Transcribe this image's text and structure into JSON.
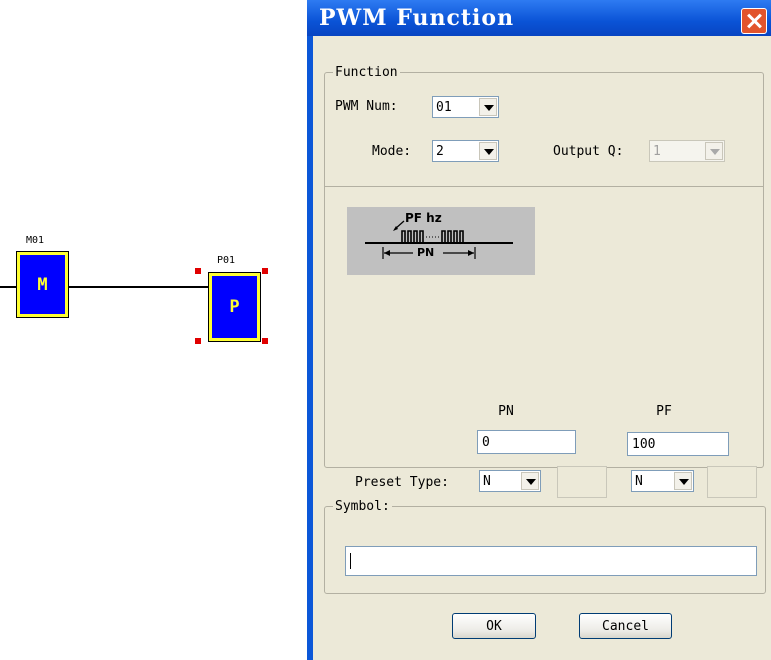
{
  "ladder": {
    "m_block": {
      "label": "M01",
      "letter": "M"
    },
    "p_block": {
      "label": "P01",
      "letter": "P"
    }
  },
  "dialog": {
    "title": "PWM Function",
    "function_group": {
      "legend": "Function",
      "pwm_num_label": "PWM Num:",
      "pwm_num_value": "01",
      "mode_label": "Mode:",
      "mode_value": "2",
      "output_q_label": "Output Q:",
      "output_q_value": "1"
    },
    "diagram": {
      "pf_text": "PF hz",
      "pn_text": "PN"
    },
    "params": {
      "pn_header": "PN",
      "pf_header": "PF",
      "pn_value": "0",
      "pf_value": "100",
      "preset_type_label": "Preset Type:",
      "pn_preset_type": "N",
      "pf_preset_type": "N"
    },
    "symbol_group": {
      "legend": "Symbol:",
      "value": ""
    },
    "buttons": {
      "ok": "OK",
      "cancel": "Cancel"
    }
  },
  "colors": {
    "titlebar": "#0a53d6",
    "dialog_face": "#ece9d8",
    "block_fill": "#0000ff",
    "block_border": "#ffff33",
    "handle": "#e00000"
  }
}
